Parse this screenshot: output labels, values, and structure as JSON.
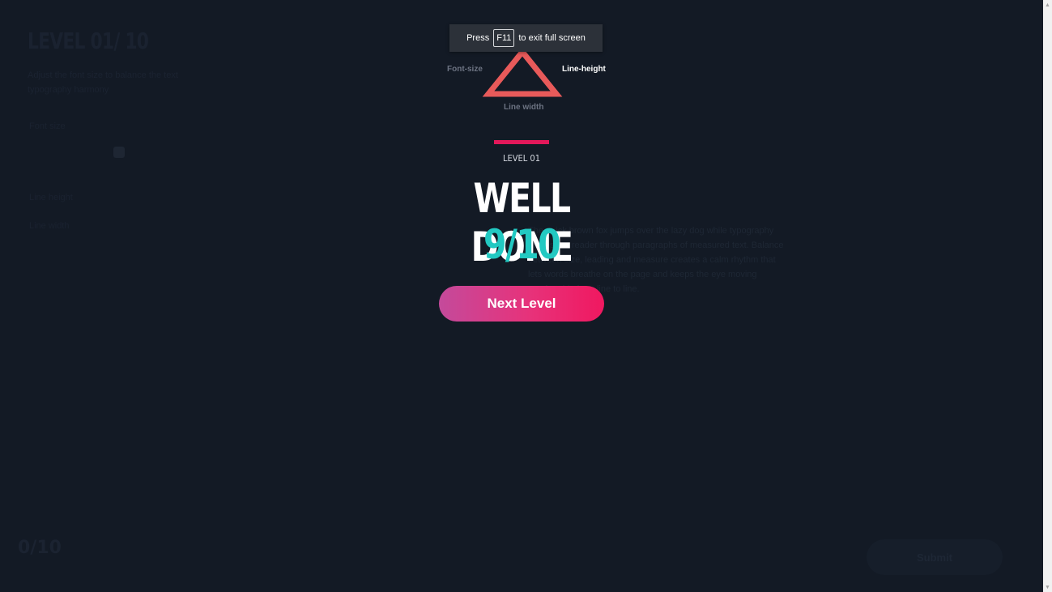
{
  "background": {
    "title": "LEVEL 01/ 10",
    "description": "Adjust the font size to balance the text typography harmony",
    "controls": [
      "Font size",
      "Line height",
      "Line width"
    ],
    "sample_text": "The quick brown fox jumps over the lazy dog while typography guides the reader through paragraphs of measured text. Balance between size, leading and measure creates a calm rhythm that lets words breathe on the page and keeps the eye moving comfortably from line to line.",
    "score": "0/10",
    "submit_label": "Submit"
  },
  "result": {
    "triangle": {
      "left_label": "Font-size",
      "right_label": "Line-height",
      "bottom_label": "Line width"
    },
    "level": "LEVEL 01",
    "heading": "WELL DONE",
    "score": "9/10",
    "next_button": "Next Level"
  },
  "fullscreen_notice": {
    "press": "Press",
    "key": "F11",
    "rest": "to exit full screen"
  },
  "colors": {
    "background": "#131a25",
    "accent": "#e3185a",
    "score": "#22c9c2",
    "triangle": "#e85a5a"
  }
}
